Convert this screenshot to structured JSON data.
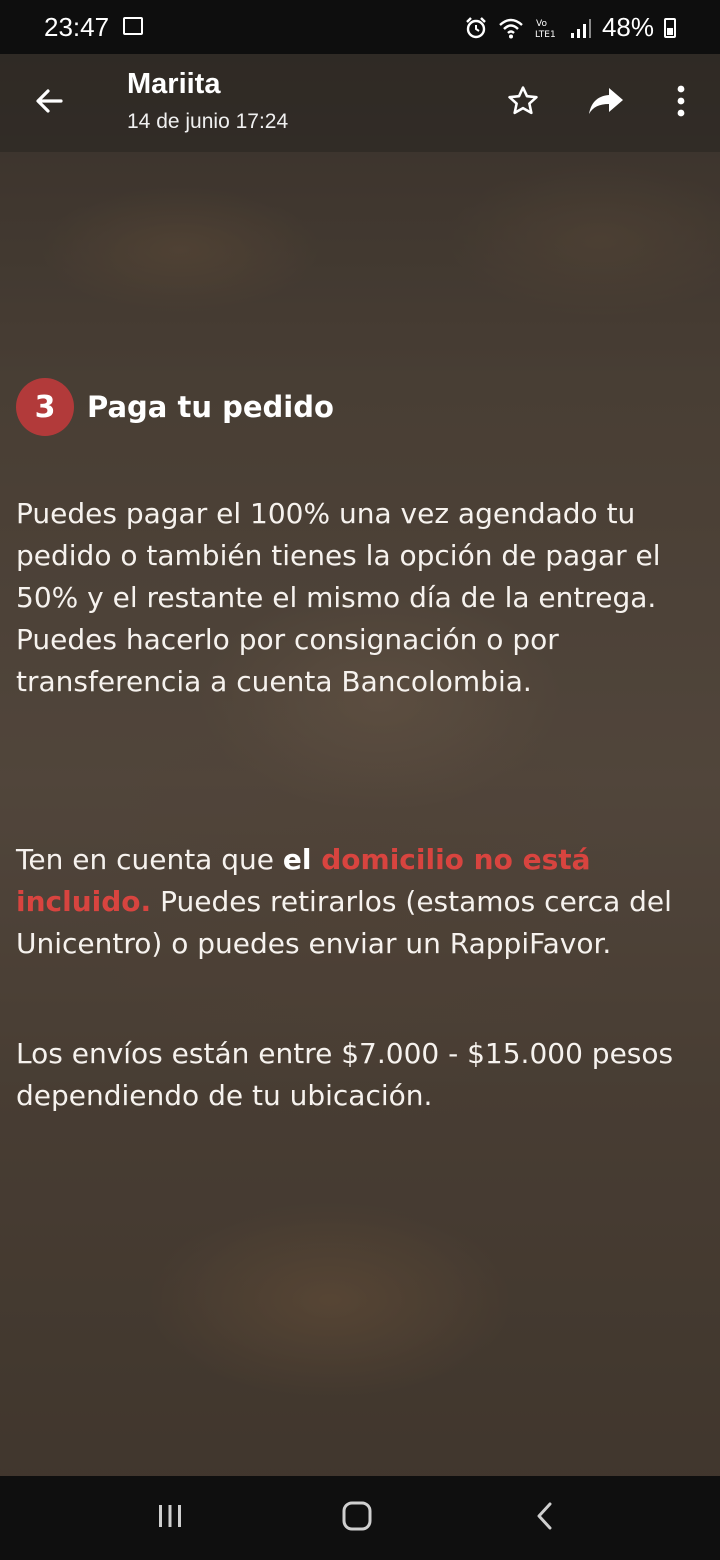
{
  "status_bar": {
    "time": "23:47",
    "battery": "48%",
    "network": "LTE1",
    "icons": [
      "gallery-icon",
      "alarm-icon",
      "wifi-icon",
      "volte-icon",
      "signal-icon",
      "battery-icon"
    ]
  },
  "app_bar": {
    "sender": "Mariita",
    "date": "14 de junio 17:24",
    "icons": [
      "back-arrow-icon",
      "star-icon",
      "share-icon",
      "more-vert-icon"
    ]
  },
  "content": {
    "step_number": "3",
    "step_title": "Paga tu pedido",
    "paragraph_1": "Puedes pagar el 100% una vez agendado tu pedido o también tienes la opción de pagar el 50% y el restante el mismo día de la entrega. Puedes hacerlo por consignación o por transferencia a cuenta Bancolombia.",
    "paragraph_2": {
      "lead": "Ten en cuenta que ",
      "bold": "el ",
      "highlight": "domicilio no está incluido.",
      "rest": " Puedes retirarlos (estamos cerca del Unicentro) o puedes enviar un RappiFavor."
    },
    "paragraph_3": "Los envíos están entre $7.000 - $15.000 pesos dependiendo de tu ubicación.",
    "colors": {
      "accent_red": "#b23a3a",
      "highlight_red": "#d8443f"
    }
  },
  "nav_bar": {
    "icons": [
      "recents-icon",
      "home-icon",
      "back-icon"
    ]
  }
}
